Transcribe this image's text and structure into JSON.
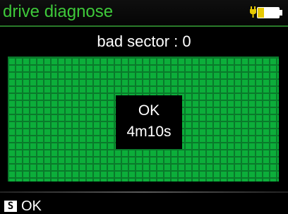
{
  "header": {
    "title": "drive diagnose",
    "battery_icon": "battery-charging-icon"
  },
  "status": {
    "text": "bad sector : 0"
  },
  "result": {
    "status": "OK",
    "elapsed": "4m10s"
  },
  "softkeys": {
    "s_badge": "S",
    "s_label": "OK"
  },
  "colors": {
    "title_text": "#3ec93a",
    "grid_fill": "#0cae3a",
    "grid_lines": "#0a7a2b",
    "background": "#000000"
  }
}
